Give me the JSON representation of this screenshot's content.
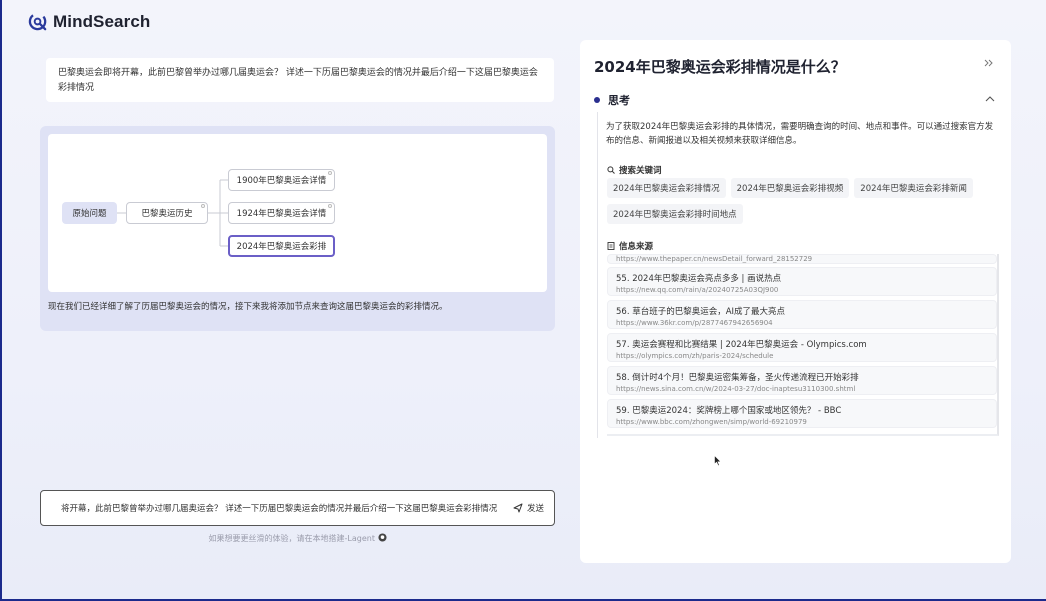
{
  "app": {
    "name": "MindSearch"
  },
  "chat": {
    "query": "巴黎奥运会即将开幕，此前巴黎曾举办过哪几届奥运会？ 详述一下历届巴黎奥运会的情况并最后介绍一下这届巴黎奥运会彩排情况"
  },
  "graph": {
    "nodes": {
      "root": "原始问题",
      "history": "巴黎奥运历史",
      "n1900": "1900年巴黎奥运会详情",
      "n1924": "1924年巴黎奥运会详情",
      "n2024": "2024年巴黎奥运会彩排"
    },
    "caption": "现在我们已经详细了解了历届巴黎奥运会的情况，接下来我将添加节点来查询这届巴黎奥运会的彩排情况。"
  },
  "input": {
    "value": "将开幕，此前巴黎曾举办过哪几届奥运会？ 详述一下历届巴黎奥运会的情况并最后介绍一下这届巴黎奥运会彩排情况",
    "send_label": "发送"
  },
  "footnote": "如果想要更丝滑的体验，请在本地搭建-Lagent",
  "detail": {
    "title": "2024年巴黎奥运会彩排情况是什么？",
    "think_label": "思考",
    "think_text": "为了获取2024年巴黎奥运会彩排的具体情况，需要明确查询的时间、地点和事件。可以通过搜索官方发布的信息、新闻报道以及相关视频来获取详细信息。",
    "keywords_label": "搜索关键词",
    "keywords": [
      "2024年巴黎奥运会彩排情况",
      "2024年巴黎奥运会彩排视频",
      "2024年巴黎奥运会彩排新闻",
      "2024年巴黎奥运会彩排时间地点"
    ],
    "sources_label": "信息来源",
    "sources_partial_url": "https://www.thepaper.cn/newsDetail_forward_28152729",
    "sources": [
      {
        "title": "55. 2024年巴黎奥运会亮点多多 | 画说热点",
        "url": "https://new.qq.com/rain/a/20240725A03QJ900"
      },
      {
        "title": "56. 草台班子的巴黎奥运会，AI成了最大亮点",
        "url": "https://www.36kr.com/p/2877467942656904"
      },
      {
        "title": "57. 奥运会赛程和比赛结果 | 2024年巴黎奥运会 - Olympics.com",
        "url": "https://olympics.com/zh/paris-2024/schedule"
      },
      {
        "title": "58. 倒计时4个月！巴黎奥运密集筹备，圣火传递流程已开始彩排",
        "url": "https://news.sina.com.cn/w/2024-03-27/doc-inaptesu3110300.shtml"
      },
      {
        "title": "59. 巴黎奥运2024：奖牌榜上哪个国家或地区领先？ - BBC",
        "url": "https://www.bbc.com/zhongwen/simp/world-69210979"
      }
    ]
  },
  "colors": {
    "accent": "#6b5fc7",
    "brand": "#1b2a8c",
    "panel": "#dfe2f5"
  }
}
